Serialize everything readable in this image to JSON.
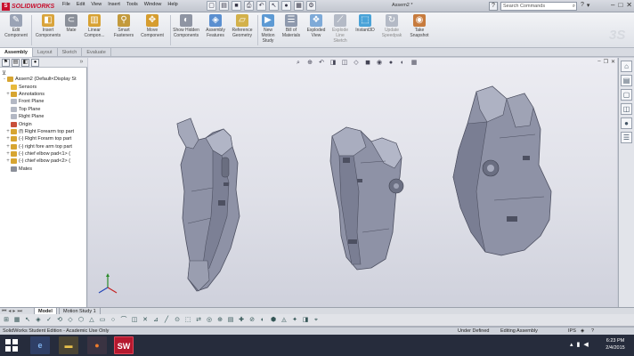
{
  "app": {
    "brand": "SOLIDWORKS",
    "document_title": "Assem2 *",
    "menus": [
      "File",
      "Edit",
      "View",
      "Insert",
      "Tools",
      "Window",
      "Help"
    ],
    "search_placeholder": "Search Commands",
    "watermark": "3S"
  },
  "commands": [
    {
      "label": "Edit Component",
      "icon": "edit-component-icon",
      "color": "#9aa3b5",
      "dim": true
    },
    {
      "label": "Insert Components",
      "icon": "insert-components-icon",
      "color": "#d9a43b",
      "dim": false
    },
    {
      "label": "Mate",
      "icon": "mate-icon",
      "color": "#8a8f99",
      "dim": false
    },
    {
      "label": "Linear Compon...",
      "icon": "linear-pattern-icon",
      "color": "#d8a233",
      "dim": false
    },
    {
      "label": "Smart Fasteners",
      "icon": "smart-fasteners-icon",
      "color": "#c39a3c",
      "dim": false
    },
    {
      "label": "Move Component",
      "icon": "move-component-icon",
      "color": "#d69d2f",
      "dim": false
    },
    {
      "label": "Show Hidden Components",
      "icon": "show-hidden-icon",
      "color": "#8f95a3",
      "dim": false
    },
    {
      "label": "Assembly Features",
      "icon": "assembly-features-icon",
      "color": "#5a8fd0",
      "dim": false
    },
    {
      "label": "Reference Geometry",
      "icon": "reference-geometry-icon",
      "color": "#d3b14a",
      "dim": false
    },
    {
      "label": "New Motion Study",
      "icon": "motion-study-icon",
      "color": "#5d9ad4",
      "dim": false
    },
    {
      "label": "Bill of Materials",
      "icon": "bill-of-materials-icon",
      "color": "#8e99ad",
      "dim": false
    },
    {
      "label": "Exploded View",
      "icon": "exploded-view-icon",
      "color": "#7eaad8",
      "dim": false
    },
    {
      "label": "Explode Line Sketch",
      "icon": "explode-line-sketch-icon",
      "color": "#b4bac6",
      "dim": true
    },
    {
      "label": "Instant3D",
      "icon": "instant3d-icon",
      "color": "#4aa3d8",
      "dim": false
    },
    {
      "label": "Update Speedpak",
      "icon": "update-speedpak-icon",
      "color": "#b4bac6",
      "dim": true
    },
    {
      "label": "Take Snapshot",
      "icon": "take-snapshot-icon",
      "color": "#c77b3d",
      "dim": false
    }
  ],
  "tabs": [
    "Assembly",
    "Layout",
    "Sketch",
    "Evaluate"
  ],
  "active_tab": "Assembly",
  "feature_tree": [
    {
      "label": "Assem2  (Default<Display St",
      "icon": "assembly-icon",
      "expander": "-",
      "indent": 0,
      "color": "#d7a531"
    },
    {
      "label": "Sensors",
      "icon": "sensors-icon",
      "expander": "",
      "indent": 1,
      "color": "#e7b93b"
    },
    {
      "label": "Annotations",
      "icon": "annotations-icon",
      "expander": "+",
      "indent": 1,
      "color": "#d7a531"
    },
    {
      "label": "Front Plane",
      "icon": "plane-icon",
      "expander": "",
      "indent": 1,
      "color": "#b3b8c4"
    },
    {
      "label": "Top Plane",
      "icon": "plane-icon",
      "expander": "",
      "indent": 1,
      "color": "#b3b8c4"
    },
    {
      "label": "Right Plane",
      "icon": "plane-icon",
      "expander": "",
      "indent": 1,
      "color": "#b3b8c4"
    },
    {
      "label": "Origin",
      "icon": "origin-icon",
      "expander": "",
      "indent": 1,
      "color": "#c84f3a"
    },
    {
      "label": "(f) Right Forearm top part",
      "icon": "part-icon",
      "expander": "+",
      "indent": 1,
      "color": "#d7a531"
    },
    {
      "label": "(-) Right Forarm top part",
      "icon": "part-icon",
      "expander": "+",
      "indent": 1,
      "color": "#d7a531"
    },
    {
      "label": "(-) right fore arm top part",
      "icon": "part-icon",
      "expander": "+",
      "indent": 1,
      "color": "#d7a531"
    },
    {
      "label": "(-) chief elbow pad<1> (",
      "icon": "part-icon",
      "expander": "+",
      "indent": 1,
      "color": "#d7a531"
    },
    {
      "label": "(-) chief elbow pad<2> (",
      "icon": "part-icon",
      "expander": "+",
      "indent": 1,
      "color": "#d7a531"
    },
    {
      "label": "Mates",
      "icon": "mates-icon",
      "expander": "",
      "indent": 1,
      "color": "#8b8f99"
    }
  ],
  "bottom_tabs": [
    "Model",
    "Motion Study 1"
  ],
  "active_bottom_tab": "Model",
  "status": {
    "left": "SolidWorks Student Edition - Academic Use Only",
    "under_defined": "Under Defined",
    "editing": "Editing Assembly",
    "units": "IPS"
  },
  "taskbar": {
    "time": "6:23 PM",
    "date": "2/4/2015"
  },
  "model_color": "#8e92a6"
}
